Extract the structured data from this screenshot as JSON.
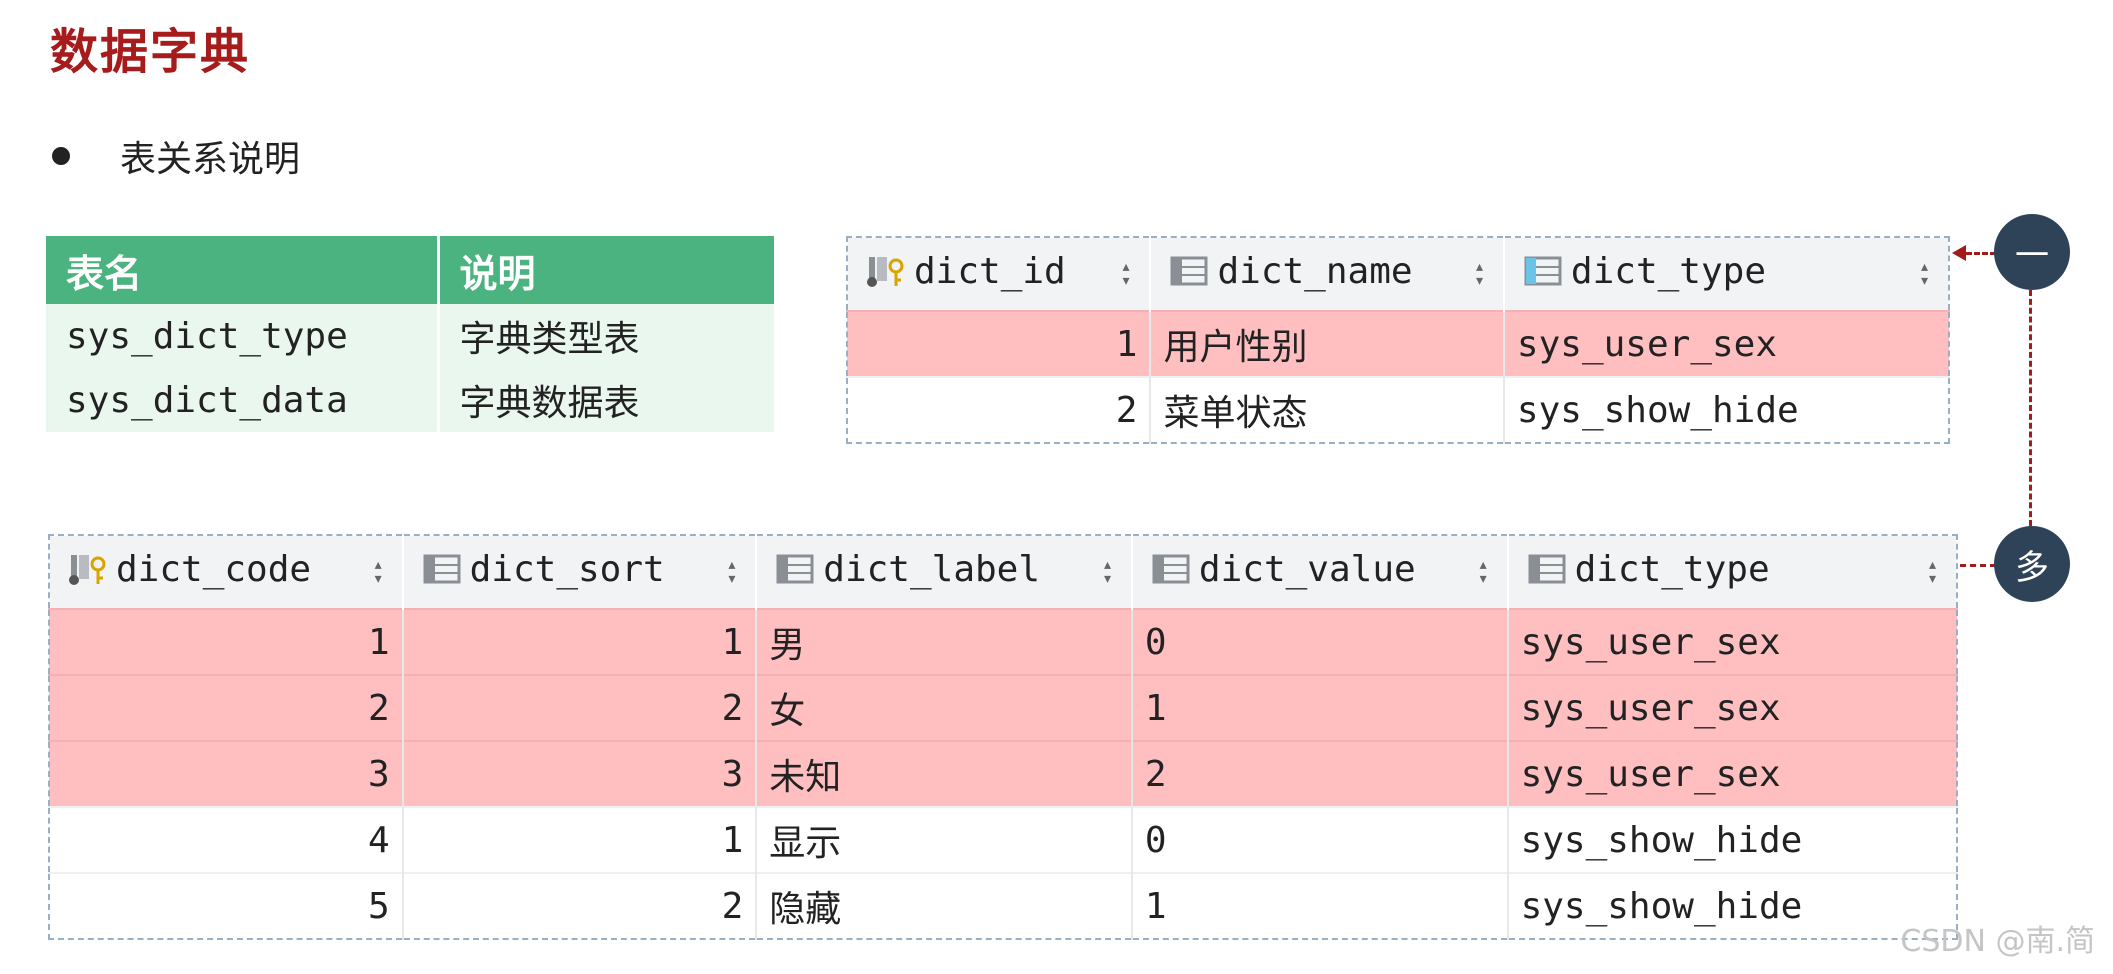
{
  "title": "数据字典",
  "bullet": "表关系说明",
  "info_table": {
    "headers": [
      "表名",
      "说明"
    ],
    "rows": [
      [
        "sys_dict_type",
        "字典类型表"
      ],
      [
        "sys_dict_data",
        "字典数据表"
      ]
    ]
  },
  "type_table": {
    "headers": [
      "dict_id",
      "dict_name",
      "dict_type"
    ],
    "rows": [
      {
        "dict_id": "1",
        "dict_name": "用户性别",
        "dict_type": "sys_user_sex",
        "highlight": true
      },
      {
        "dict_id": "2",
        "dict_name": "菜单状态",
        "dict_type": "sys_show_hide",
        "highlight": false
      }
    ]
  },
  "data_table": {
    "headers": [
      "dict_code",
      "dict_sort",
      "dict_label",
      "dict_value",
      "dict_type"
    ],
    "rows": [
      {
        "dict_code": "1",
        "dict_sort": "1",
        "dict_label": "男",
        "dict_value": "0",
        "dict_type": "sys_user_sex",
        "highlight": true
      },
      {
        "dict_code": "2",
        "dict_sort": "2",
        "dict_label": "女",
        "dict_value": "1",
        "dict_type": "sys_user_sex",
        "highlight": true
      },
      {
        "dict_code": "3",
        "dict_sort": "3",
        "dict_label": "未知",
        "dict_value": "2",
        "dict_type": "sys_user_sex",
        "highlight": true
      },
      {
        "dict_code": "4",
        "dict_sort": "1",
        "dict_label": "显示",
        "dict_value": "0",
        "dict_type": "sys_show_hide",
        "highlight": false
      },
      {
        "dict_code": "5",
        "dict_sort": "2",
        "dict_label": "隐藏",
        "dict_value": "1",
        "dict_type": "sys_show_hide",
        "highlight": false
      }
    ]
  },
  "relation": {
    "one_label": "一",
    "many_label": "多"
  },
  "watermark": "CSDN @南.简",
  "colors": {
    "title": "#a61b1b",
    "header_green": "#4bb37f",
    "row_green": "#eaf7ef",
    "highlight_pink": "#ffbfc1",
    "relation_red": "#a31b1b",
    "circle_navy": "#2f4358"
  },
  "icons": {
    "key_column": "primary-key-column-icon",
    "column": "table-column-icon",
    "sort": "sort-arrows-icon"
  }
}
